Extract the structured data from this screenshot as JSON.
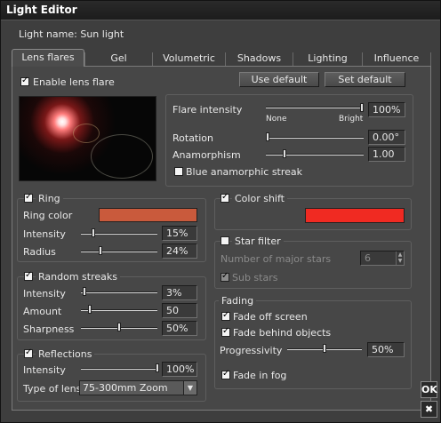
{
  "window": {
    "title": "Light Editor"
  },
  "light_name": "Light name: Sun light",
  "tabs": [
    "Lens flares",
    "Gel",
    "Volumetric",
    "Shadows",
    "Lighting",
    "Influence"
  ],
  "active_tab": "Lens flares",
  "enable_lens_flare": {
    "label": "Enable lens flare",
    "checked": true
  },
  "buttons": {
    "use_default": "Use default",
    "set_default": "Set default",
    "ok": "OK",
    "close_icon": "close-icon"
  },
  "flare": {
    "intensity_label": "Flare intensity",
    "intensity_value": "100%",
    "intensity_level": 1.0,
    "none_label": "None",
    "bright_label": "Bright",
    "rotation_label": "Rotation",
    "rotation_value": "0.00°",
    "rotation_level": 0.0,
    "anamorphism_label": "Anamorphism",
    "anamorphism_value": "1.00",
    "anamorphism_level": 0.18,
    "blue_streak_label": "Blue anamorphic streak",
    "blue_streak_checked": false
  },
  "ring": {
    "label": "Ring",
    "checked": true,
    "color_label": "Ring color",
    "color": "#c95a3c",
    "intensity_label": "Intensity",
    "intensity_value": "15%",
    "intensity_level": 0.15,
    "radius_label": "Radius",
    "radius_value": "24%",
    "radius_level": 0.24
  },
  "color_shift": {
    "label": "Color shift",
    "checked": true,
    "color": "#f02a22"
  },
  "star_filter": {
    "label": "Star filter",
    "checked": false,
    "major_stars_label": "Number of major stars",
    "major_stars_value": "6",
    "sub_stars_label": "Sub stars",
    "sub_stars_checked": true
  },
  "random_streaks": {
    "label": "Random streaks",
    "checked": true,
    "intensity_label": "Intensity",
    "intensity_value": "3%",
    "intensity_level": 0.03,
    "amount_label": "Amount",
    "amount_value": "50",
    "amount_level": 0.1,
    "sharpness_label": "Sharpness",
    "sharpness_value": "50%",
    "sharpness_level": 0.5
  },
  "fading": {
    "label": "Fading",
    "fade_off_screen_label": "Fade off screen",
    "fade_off_screen_checked": true,
    "fade_behind_label": "Fade behind objects",
    "fade_behind_checked": true,
    "progressivity_label": "Progressivity",
    "progressivity_value": "50%",
    "progressivity_level": 0.5,
    "fade_in_fog_label": "Fade in fog",
    "fade_in_fog_checked": true
  },
  "reflections": {
    "label": "Reflections",
    "checked": true,
    "intensity_label": "Intensity",
    "intensity_value": "100%",
    "intensity_level": 1.0,
    "type_label": "Type of lens",
    "type_value": "75-300mm Zoom"
  },
  "colors": {
    "window_bg": "#3e3e3e",
    "panel_bg": "#474747",
    "title_bg": "#1c1c1c"
  }
}
